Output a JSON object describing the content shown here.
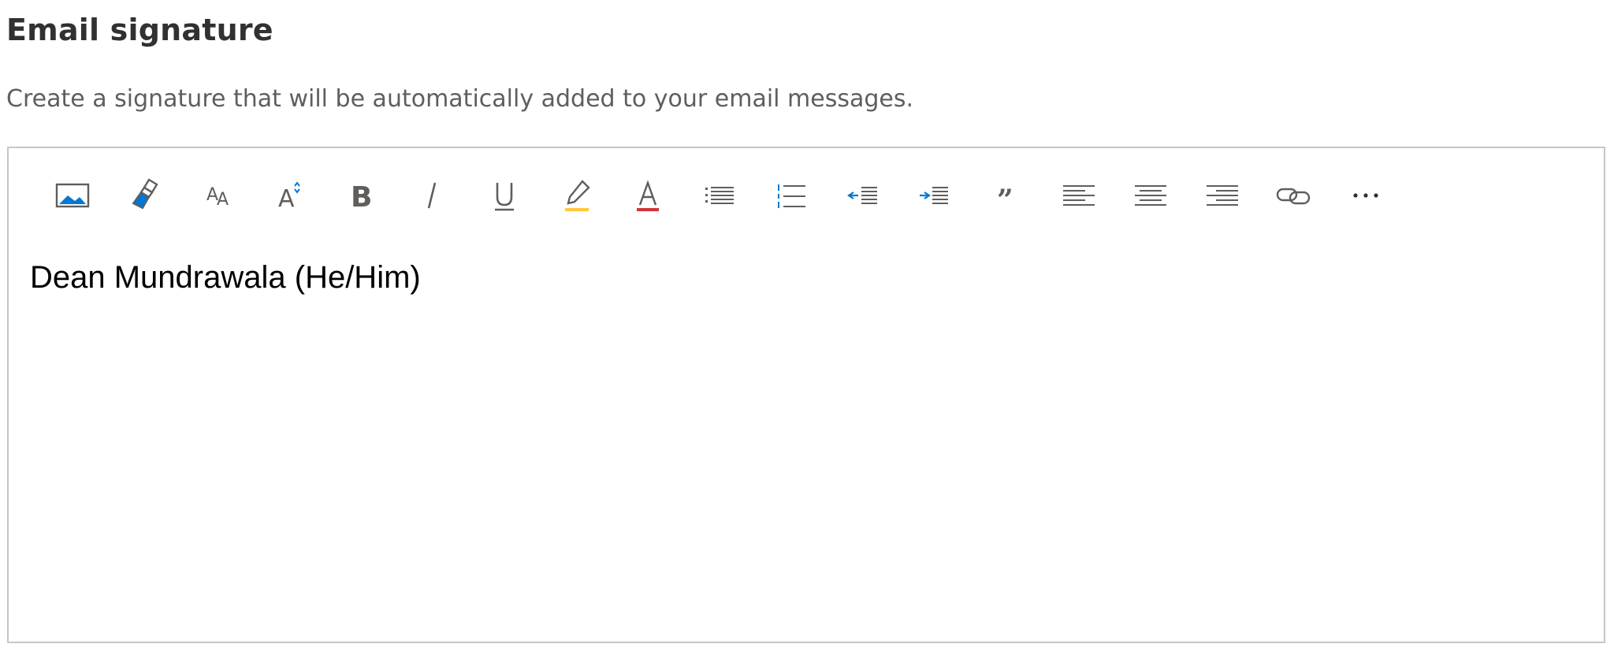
{
  "section": {
    "title": "Email signature",
    "description": "Create a signature that will be automatically added to your email messages."
  },
  "editor": {
    "signature_text": "Dean Mundrawala (He/Him)",
    "toolbar": [
      {
        "name": "insert-picture-icon",
        "label": "Insert pictures inline"
      },
      {
        "name": "format-painter-icon",
        "label": "Format painter"
      },
      {
        "name": "font-icon",
        "label": "Font"
      },
      {
        "name": "font-size-icon",
        "label": "Font size"
      },
      {
        "name": "bold-icon",
        "label": "Bold"
      },
      {
        "name": "italic-icon",
        "label": "Italic"
      },
      {
        "name": "underline-icon",
        "label": "Underline"
      },
      {
        "name": "highlight-icon",
        "label": "Highlight"
      },
      {
        "name": "font-color-icon",
        "label": "Font color"
      },
      {
        "name": "bullets-icon",
        "label": "Bullets"
      },
      {
        "name": "numbering-icon",
        "label": "Numbering"
      },
      {
        "name": "decrease-indent-icon",
        "label": "Decrease indent"
      },
      {
        "name": "increase-indent-icon",
        "label": "Increase indent"
      },
      {
        "name": "quote-icon",
        "label": "Quote"
      },
      {
        "name": "align-left-icon",
        "label": "Align left"
      },
      {
        "name": "align-center-icon",
        "label": "Align center"
      },
      {
        "name": "align-right-icon",
        "label": "Align right"
      },
      {
        "name": "link-icon",
        "label": "Insert link"
      },
      {
        "name": "more-options-icon",
        "label": "More options"
      }
    ],
    "colors": {
      "icon": "#605e5c",
      "accent_blue": "#0078d4",
      "highlight_yellow": "#ffc83d",
      "font_red": "#d13438"
    }
  }
}
